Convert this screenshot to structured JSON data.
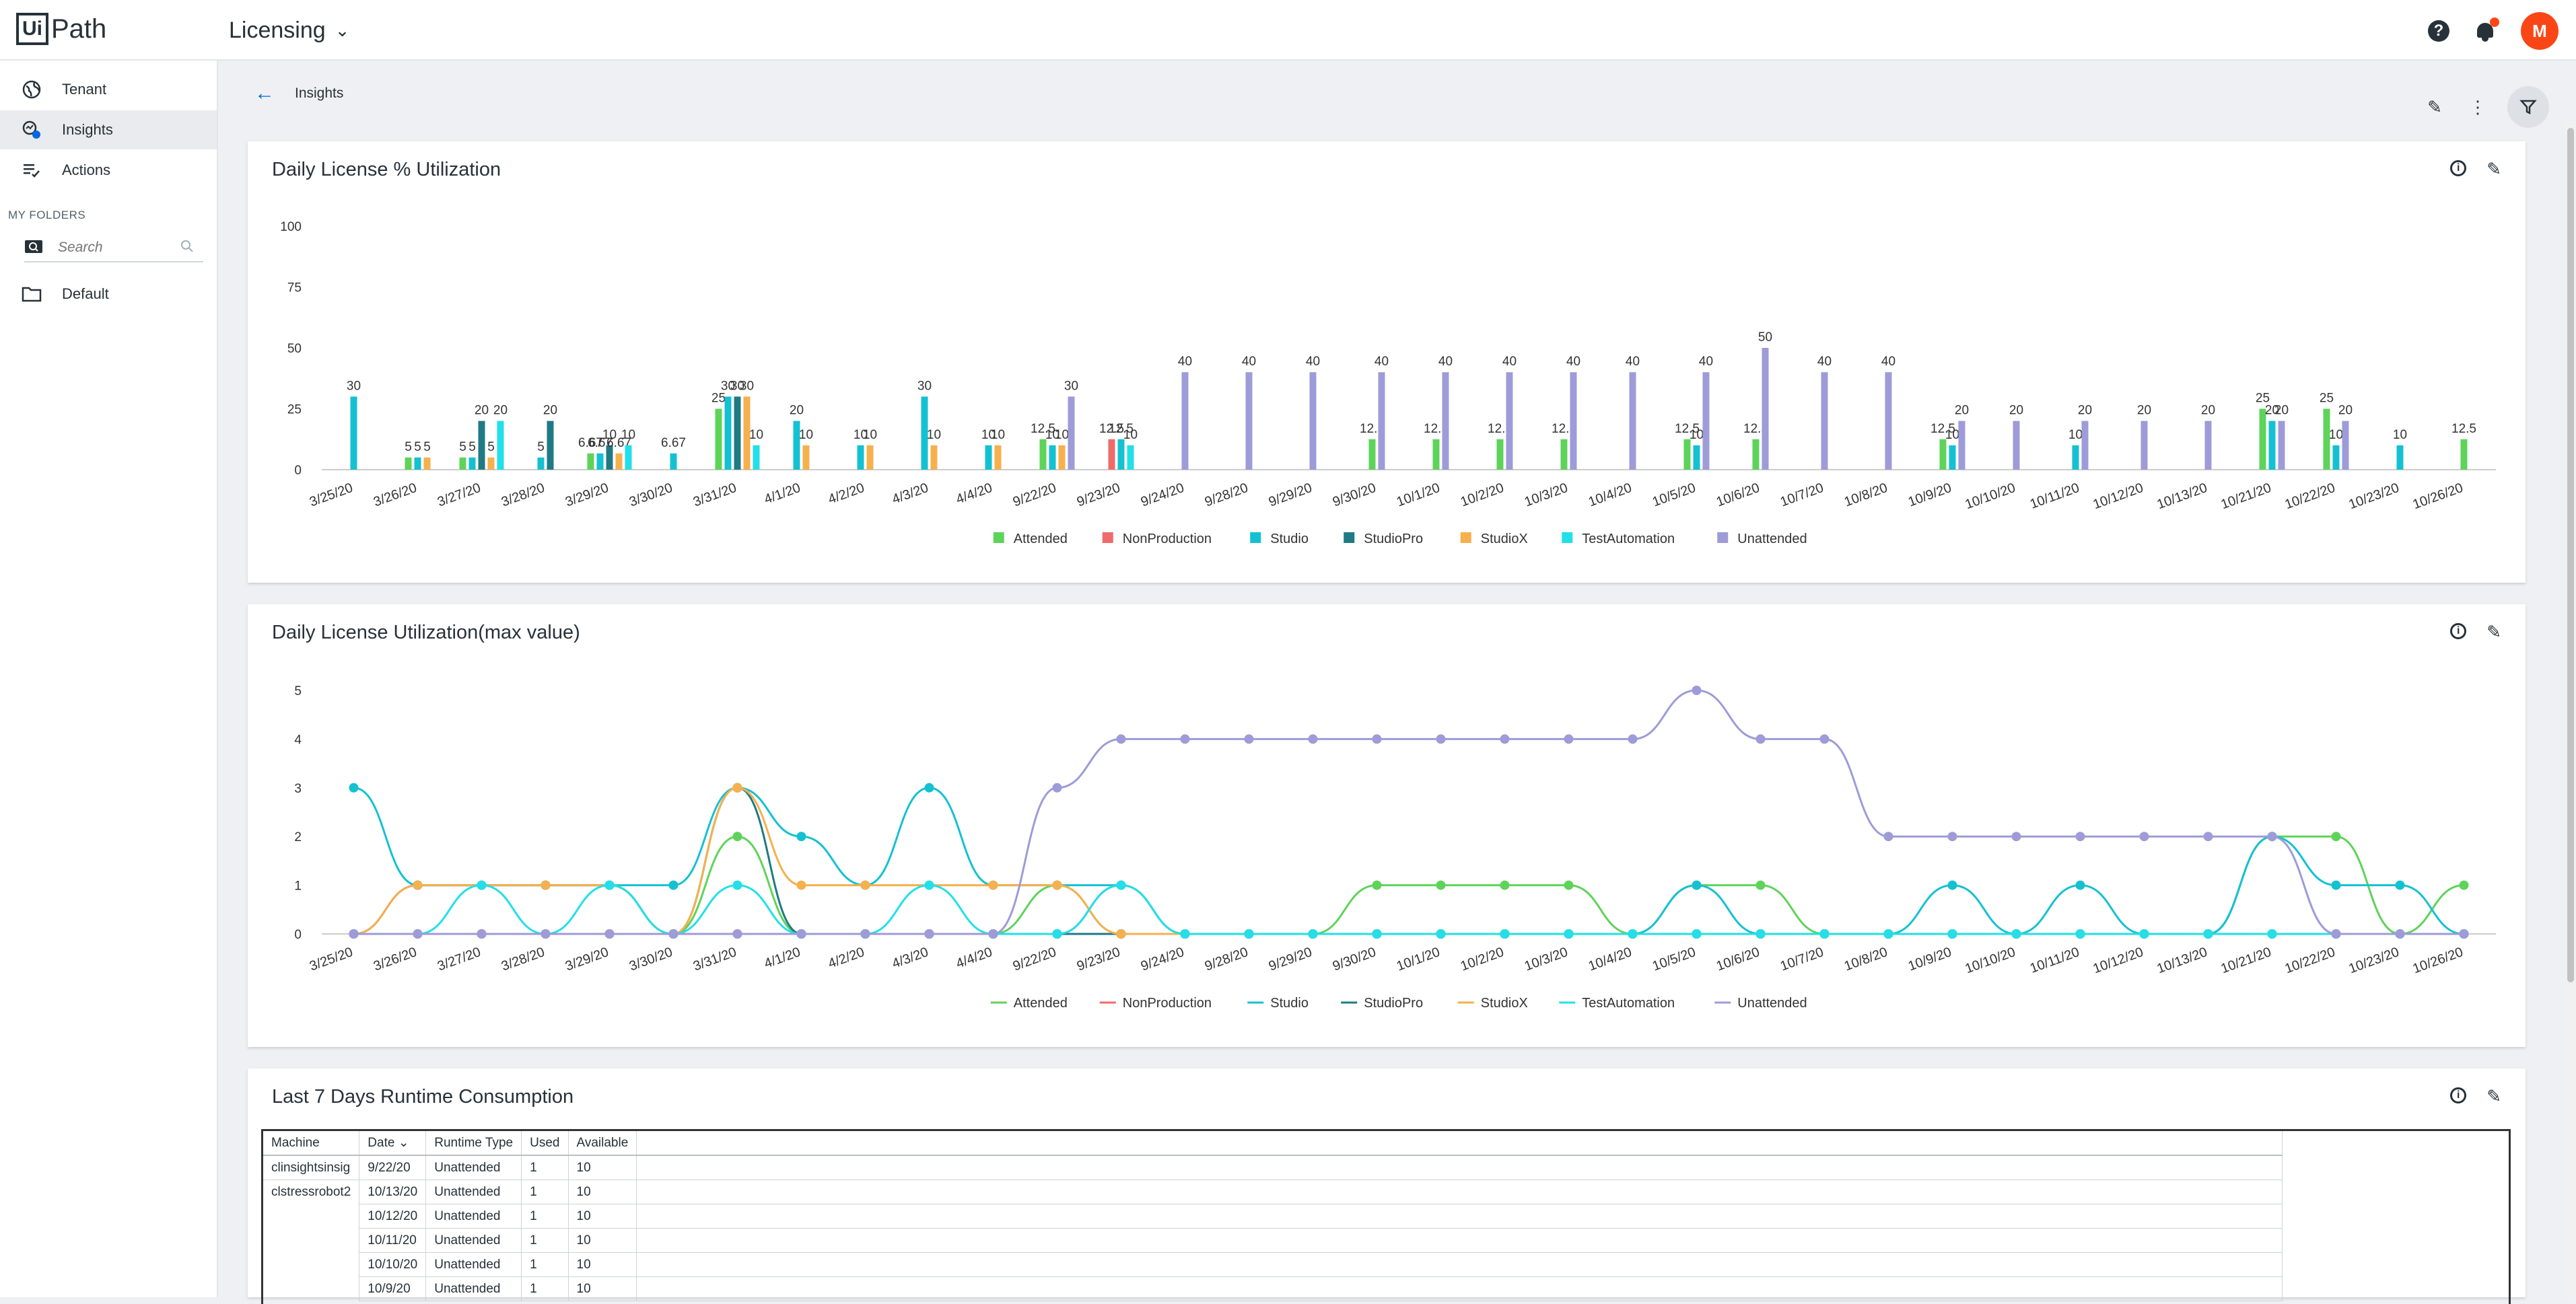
{
  "header": {
    "logo_box": "Ui",
    "logo_text": "Path",
    "title": "Licensing",
    "avatar_initial": "M"
  },
  "sidebar": {
    "items": [
      {
        "label": "Tenant",
        "icon": "globe-icon"
      },
      {
        "label": "Insights",
        "icon": "insights-icon"
      },
      {
        "label": "Actions",
        "icon": "actions-icon"
      }
    ],
    "section_label": "MY FOLDERS",
    "search_placeholder": "Search",
    "folder": "Default"
  },
  "breadcrumb": {
    "label": "Insights"
  },
  "cards": {
    "bar": {
      "title": "Daily License % Utilization"
    },
    "line": {
      "title": "Daily License Utilization(max value)"
    },
    "table": {
      "title": "Last 7 Days Runtime Consumption"
    }
  },
  "colors": {
    "Attended": "#5ed35a",
    "NonProduction": "#f06a6a",
    "Studio": "#14c1d1",
    "StudioPro": "#1f7a85",
    "StudioX": "#f6b04e",
    "TestAutomation": "#22dfe8",
    "Unattended": "#9d9bd8"
  },
  "chart_data": [
    {
      "type": "bar",
      "title": "Daily License % Utilization",
      "categories": [
        "3/25/20",
        "3/26/20",
        "3/27/20",
        "3/28/20",
        "3/29/20",
        "3/30/20",
        "3/31/20",
        "4/1/20",
        "4/2/20",
        "4/3/20",
        "4/4/20",
        "9/22/20",
        "9/23/20",
        "9/24/20",
        "9/28/20",
        "9/29/20",
        "9/30/20",
        "10/1/20",
        "10/2/20",
        "10/3/20",
        "10/4/20",
        "10/5/20",
        "10/6/20",
        "10/7/20",
        "10/8/20",
        "10/9/20",
        "10/10/20",
        "10/11/20",
        "10/12/20",
        "10/13/20",
        "10/21/20",
        "10/22/20",
        "10/23/20",
        "10/26/20"
      ],
      "ylim": [
        0,
        100
      ],
      "yticks": [
        0,
        25,
        50,
        75,
        100
      ],
      "legend": "bottom",
      "series": [
        {
          "name": "Attended",
          "values": [
            0,
            5,
            5,
            0,
            6.67,
            0,
            25,
            0,
            0,
            0,
            0,
            12.5,
            0,
            0,
            0,
            0,
            12.5,
            12.5,
            12.5,
            12.5,
            0,
            12.5,
            12.5,
            0,
            0,
            12.5,
            0,
            0,
            0,
            0,
            25,
            25,
            0,
            12.5
          ]
        },
        {
          "name": "NonProduction",
          "values": [
            0,
            0,
            0,
            0,
            0,
            0,
            0,
            0,
            0,
            0,
            0,
            0,
            12.5,
            0,
            0,
            0,
            0,
            0,
            0,
            0,
            0,
            0,
            0,
            0,
            0,
            0,
            0,
            0,
            0,
            0,
            0,
            0,
            0,
            0
          ]
        },
        {
          "name": "Studio",
          "values": [
            30,
            5,
            5,
            5,
            6.67,
            6.67,
            30,
            20,
            10,
            30,
            10,
            10,
            12.5,
            0,
            0,
            0,
            0,
            0,
            0,
            0,
            0,
            10,
            0,
            0,
            0,
            10,
            0,
            10,
            0,
            0,
            20,
            10,
            10,
            0
          ]
        },
        {
          "name": "StudioPro",
          "values": [
            0,
            0,
            20,
            20,
            10,
            0,
            30,
            0,
            0,
            0,
            0,
            0,
            0,
            0,
            0,
            0,
            0,
            0,
            0,
            0,
            0,
            0,
            0,
            0,
            0,
            0,
            0,
            0,
            0,
            0,
            0,
            0,
            0,
            0
          ]
        },
        {
          "name": "StudioX",
          "values": [
            0,
            5,
            5,
            0,
            6.67,
            0,
            30,
            10,
            10,
            10,
            10,
            10,
            0,
            0,
            0,
            0,
            0,
            0,
            0,
            0,
            0,
            0,
            0,
            0,
            0,
            0,
            0,
            0,
            0,
            0,
            0,
            0,
            0,
            0
          ]
        },
        {
          "name": "TestAutomation",
          "values": [
            0,
            0,
            20,
            0,
            10,
            0,
            10,
            0,
            0,
            0,
            0,
            0,
            10,
            0,
            0,
            0,
            0,
            0,
            0,
            0,
            0,
            0,
            0,
            0,
            0,
            0,
            0,
            0,
            0,
            0,
            0,
            0,
            0,
            0
          ]
        },
        {
          "name": "Unattended",
          "values": [
            0,
            0,
            0,
            0,
            0,
            0,
            0,
            0,
            0,
            0,
            0,
            30,
            0,
            40,
            40,
            40,
            40,
            40,
            40,
            40,
            40,
            40,
            50,
            40,
            40,
            20,
            20,
            20,
            20,
            20,
            20,
            20,
            0,
            0
          ]
        }
      ]
    },
    {
      "type": "line",
      "title": "Daily License Utilization(max value)",
      "categories": [
        "3/25/20",
        "3/26/20",
        "3/27/20",
        "3/28/20",
        "3/29/20",
        "3/30/20",
        "3/31/20",
        "4/1/20",
        "4/2/20",
        "4/3/20",
        "4/4/20",
        "9/22/20",
        "9/23/20",
        "9/24/20",
        "9/28/20",
        "9/29/20",
        "9/30/20",
        "10/1/20",
        "10/2/20",
        "10/3/20",
        "10/4/20",
        "10/5/20",
        "10/6/20",
        "10/7/20",
        "10/8/20",
        "10/9/20",
        "10/10/20",
        "10/11/20",
        "10/12/20",
        "10/13/20",
        "10/21/20",
        "10/22/20",
        "10/23/20",
        "10/26/20"
      ],
      "ylim": [
        0,
        5
      ],
      "yticks": [
        0,
        1,
        2,
        3,
        4,
        5
      ],
      "legend": "bottom",
      "series": [
        {
          "name": "Attended",
          "values": [
            0,
            0,
            0,
            0,
            0,
            0,
            2,
            0,
            0,
            0,
            0,
            1,
            0,
            0,
            0,
            0,
            1,
            1,
            1,
            1,
            0,
            1,
            1,
            0,
            0,
            0,
            0,
            0,
            0,
            0,
            2,
            2,
            0,
            1
          ]
        },
        {
          "name": "NonProduction",
          "values": [
            0,
            0,
            0,
            0,
            0,
            0,
            0,
            0,
            0,
            0,
            0,
            0,
            1,
            0,
            0,
            0,
            0,
            0,
            0,
            0,
            0,
            0,
            0,
            0,
            0,
            0,
            0,
            0,
            0,
            0,
            0,
            0,
            0,
            0
          ]
        },
        {
          "name": "Studio",
          "values": [
            3,
            1,
            1,
            1,
            1,
            1,
            3,
            2,
            1,
            3,
            1,
            1,
            1,
            0,
            0,
            0,
            0,
            0,
            0,
            0,
            0,
            1,
            0,
            0,
            0,
            1,
            0,
            1,
            0,
            0,
            2,
            1,
            1,
            0
          ]
        },
        {
          "name": "StudioPro",
          "values": [
            0,
            1,
            1,
            1,
            1,
            0,
            3,
            0,
            0,
            0,
            0,
            0,
            0,
            0,
            0,
            0,
            0,
            0,
            0,
            0,
            0,
            0,
            0,
            0,
            0,
            0,
            0,
            0,
            0,
            0,
            0,
            0,
            0,
            0
          ]
        },
        {
          "name": "StudioX",
          "values": [
            0,
            1,
            1,
            1,
            1,
            0,
            3,
            1,
            1,
            1,
            1,
            1,
            0,
            0,
            0,
            0,
            0,
            0,
            0,
            0,
            0,
            0,
            0,
            0,
            0,
            0,
            0,
            0,
            0,
            0,
            0,
            0,
            0,
            0
          ]
        },
        {
          "name": "TestAutomation",
          "values": [
            0,
            0,
            1,
            0,
            1,
            0,
            1,
            0,
            0,
            1,
            0,
            0,
            1,
            0,
            0,
            0,
            0,
            0,
            0,
            0,
            0,
            0,
            0,
            0,
            0,
            0,
            0,
            0,
            0,
            0,
            0,
            0,
            0,
            0
          ]
        },
        {
          "name": "Unattended",
          "values": [
            0,
            0,
            0,
            0,
            0,
            0,
            0,
            0,
            0,
            0,
            0,
            3,
            4,
            4,
            4,
            4,
            4,
            4,
            4,
            4,
            4,
            5,
            4,
            4,
            2,
            2,
            2,
            2,
            2,
            2,
            2,
            0,
            0,
            0
          ]
        }
      ]
    }
  ],
  "table": {
    "columns": [
      "Machine",
      "Date",
      "Runtime Type",
      "Used",
      "Available"
    ],
    "rows": [
      [
        "clinsightsinsig",
        "9/22/20",
        "Unattended",
        "1",
        "10"
      ],
      [
        "clstressrobot2",
        "10/13/20",
        "Unattended",
        "1",
        "10"
      ],
      [
        "",
        "10/12/20",
        "Unattended",
        "1",
        "10"
      ],
      [
        "",
        "10/11/20",
        "Unattended",
        "1",
        "10"
      ],
      [
        "",
        "10/10/20",
        "Unattended",
        "1",
        "10"
      ],
      [
        "",
        "10/9/20",
        "Unattended",
        "1",
        "10"
      ]
    ]
  }
}
